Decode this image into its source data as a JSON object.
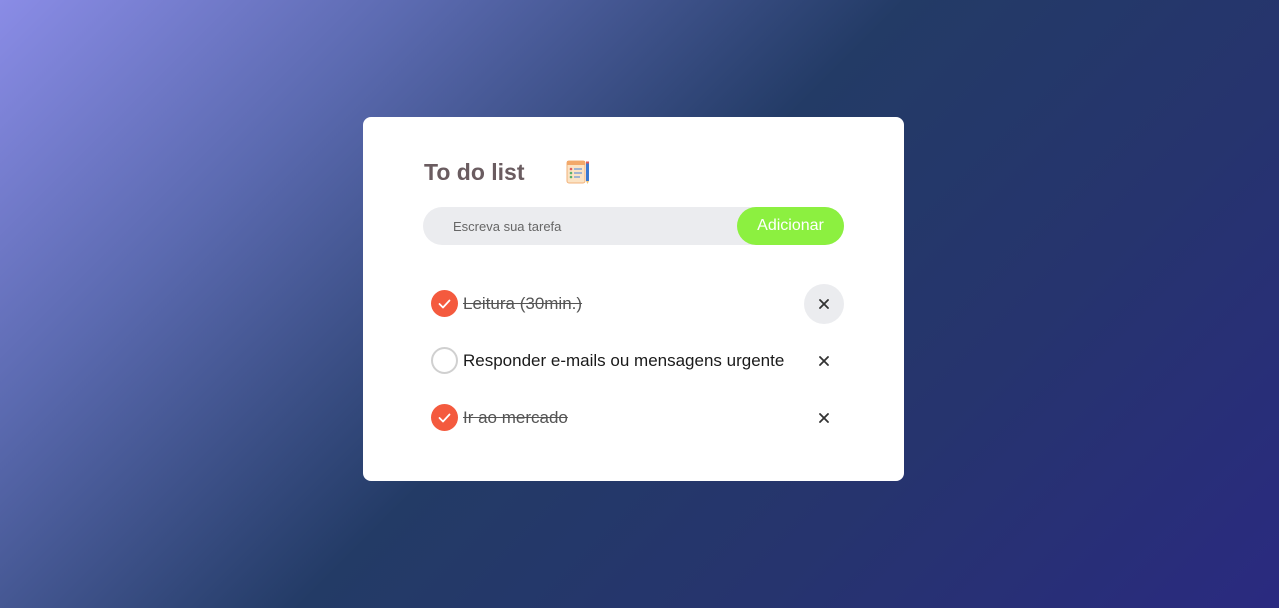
{
  "app": {
    "title": "To do list",
    "title_icon": "notepad-icon"
  },
  "form": {
    "placeholder": "Escreva sua tarefa",
    "add_label": "Adicionar"
  },
  "tasks": [
    {
      "text": "Leitura (30min.)",
      "done": true,
      "delete_icon": "close-icon",
      "delete_label": "×"
    },
    {
      "text": "Responder e-mails ou mensagens urgente",
      "done": false,
      "delete_icon": "close-icon",
      "delete_label": "×"
    },
    {
      "text": "Ir ao mercado",
      "done": true,
      "delete_icon": "close-icon",
      "delete_label": "×"
    }
  ],
  "colors": {
    "accent_done": "#f45a3e",
    "add_button": "#8cf040",
    "input_bg": "#ebecef"
  }
}
